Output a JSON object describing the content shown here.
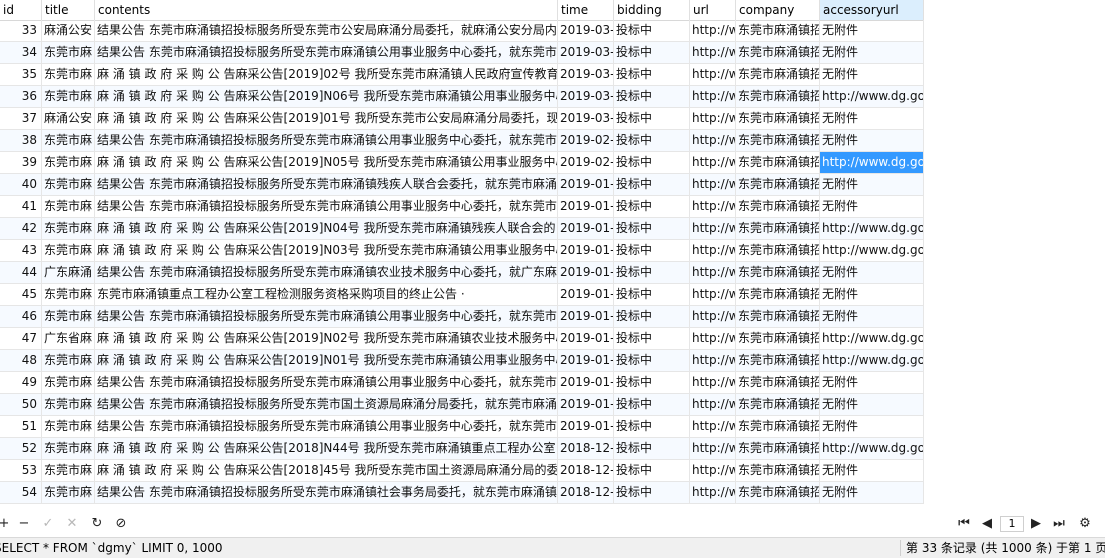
{
  "columns": [
    "id",
    "title",
    "contents",
    "time",
    "bidding",
    "url",
    "company",
    "accessoryurl"
  ],
  "rows": [
    {
      "id": "33",
      "title": "麻涌公安",
      "contents": "结果公告 东莞市麻涌镇招投标服务所受东莞市公安局麻涌分局委托，就麻涌公安分局内",
      "time": "2019-03-",
      "bidding": "投标中",
      "url": "http://w",
      "company": "东莞市麻涌镇招",
      "accessoryurl": "无附件"
    },
    {
      "id": "34",
      "title": "东莞市麻",
      "contents": "结果公告 东莞市麻涌镇招投标服务所受东莞市麻涌镇公用事业服务中心委托，就东莞市",
      "time": "2019-03-",
      "bidding": "投标中",
      "url": "http://w",
      "company": "东莞市麻涌镇招",
      "accessoryurl": "无附件"
    },
    {
      "id": "35",
      "title": "东莞市麻",
      "contents": "麻 涌 镇 政 府 采 购 公 告麻采公告[2019]02号 我所受东莞市麻涌镇人民政府宣传教育",
      "time": "2019-03-",
      "bidding": "投标中",
      "url": "http://w",
      "company": "东莞市麻涌镇招",
      "accessoryurl": "无附件"
    },
    {
      "id": "36",
      "title": "东莞市麻",
      "contents": "麻 涌 镇 政 府 采 购 公 告麻采公告[2019]N06号 我所受东莞市麻涌镇公用事业服务中心",
      "time": "2019-03-",
      "bidding": "投标中",
      "url": "http://w",
      "company": "东莞市麻涌镇招",
      "accessoryurl": "http://www.dg.go"
    },
    {
      "id": "37",
      "title": "麻涌公安",
      "contents": "麻 涌 镇 政 府 采 购 公 告麻采公告[2019]01号 我所受东莞市公安局麻涌分局委托，现",
      "time": "2019-03-",
      "bidding": "投标中",
      "url": "http://w",
      "company": "东莞市麻涌镇招",
      "accessoryurl": "无附件"
    },
    {
      "id": "38",
      "title": "东莞市麻",
      "contents": "结果公告 东莞市麻涌镇招投标服务所受东莞市麻涌镇公用事业服务中心委托，就东莞市",
      "time": "2019-02-",
      "bidding": "投标中",
      "url": "http://w",
      "company": "东莞市麻涌镇招",
      "accessoryurl": "无附件"
    },
    {
      "id": "39",
      "title": "东莞市麻",
      "contents": "麻 涌 镇 政 府 采 购 公 告麻采公告[2019]N05号 我所受东莞市麻涌镇公用事业服务中心",
      "time": "2019-02-",
      "bidding": "投标中",
      "url": "http://w",
      "company": "东莞市麻涌镇招",
      "accessoryurl": "http://www.dg.go",
      "highlight": true
    },
    {
      "id": "40",
      "title": "东莞市麻",
      "contents": "结果公告 东莞市麻涌镇招投标服务所受东莞市麻涌镇残疾人联合会委托，就东莞市麻涌",
      "time": "2019-01-",
      "bidding": "投标中",
      "url": "http://w",
      "company": "东莞市麻涌镇招",
      "accessoryurl": "无附件"
    },
    {
      "id": "41",
      "title": "东莞市麻",
      "contents": "结果公告 东莞市麻涌镇招投标服务所受东莞市麻涌镇公用事业服务中心委托，就东莞市",
      "time": "2019-01-",
      "bidding": "投标中",
      "url": "http://w",
      "company": "东莞市麻涌镇招",
      "accessoryurl": "无附件"
    },
    {
      "id": "42",
      "title": "东莞市麻",
      "contents": "麻 涌 镇 政 府 采 购 公 告麻采公告[2019]N04号 我所受东莞市麻涌镇残疾人联合会的",
      "time": "2019-01-",
      "bidding": "投标中",
      "url": "http://w",
      "company": "东莞市麻涌镇招",
      "accessoryurl": "http://www.dg.go"
    },
    {
      "id": "43",
      "title": "东莞市麻",
      "contents": "麻 涌 镇 政 府 采 购 公 告麻采公告[2019]N03号 我所受东莞市麻涌镇公用事业服务中心",
      "time": "2019-01-",
      "bidding": "投标中",
      "url": "http://w",
      "company": "东莞市麻涌镇招",
      "accessoryurl": "http://www.dg.go"
    },
    {
      "id": "44",
      "title": "广东麻涌",
      "contents": "结果公告 东莞市麻涌镇招投标服务所受东莞市麻涌镇农业技术服务中心委托，就广东麻",
      "time": "2019-01-",
      "bidding": "投标中",
      "url": "http://w",
      "company": "东莞市麻涌镇招",
      "accessoryurl": "无附件"
    },
    {
      "id": "45",
      "title": "东莞市麻",
      "contents": "东莞市麻涌镇重点工程办公室工程检测服务资格采购项目的终止公告 ·",
      "time": "2019-01-",
      "bidding": "投标中",
      "url": "http://w",
      "company": "东莞市麻涌镇招",
      "accessoryurl": "无附件"
    },
    {
      "id": "46",
      "title": "东莞市麻",
      "contents": "结果公告 东莞市麻涌镇招投标服务所受东莞市麻涌镇公用事业服务中心委托，就东莞市",
      "time": "2019-01-",
      "bidding": "投标中",
      "url": "http://w",
      "company": "东莞市麻涌镇招",
      "accessoryurl": "无附件"
    },
    {
      "id": "47",
      "title": "广东省麻",
      "contents": "麻 涌 镇 政 府 采 购 公 告麻采公告[2019]N02号 我所受东莞市麻涌镇农业技术服务中心",
      "time": "2019-01-",
      "bidding": "投标中",
      "url": "http://w",
      "company": "东莞市麻涌镇招",
      "accessoryurl": "http://www.dg.go"
    },
    {
      "id": "48",
      "title": "东莞市麻",
      "contents": "麻 涌 镇 政 府 采 购 公 告麻采公告[2019]N01号 我所受东莞市麻涌镇公用事业服务中心",
      "time": "2019-01-",
      "bidding": "投标中",
      "url": "http://w",
      "company": "东莞市麻涌镇招",
      "accessoryurl": "http://www.dg.go"
    },
    {
      "id": "49",
      "title": "东莞市麻",
      "contents": "结果公告 东莞市麻涌镇招投标服务所受东莞市麻涌镇公用事业服务中心委托，就东莞市",
      "time": "2019-01-",
      "bidding": "投标中",
      "url": "http://w",
      "company": "东莞市麻涌镇招",
      "accessoryurl": "无附件"
    },
    {
      "id": "50",
      "title": "东莞市麻",
      "contents": "结果公告 东莞市麻涌镇招投标服务所受东莞市国土资源局麻涌分局委托，就东莞市麻涌",
      "time": "2019-01-",
      "bidding": "投标中",
      "url": "http://w",
      "company": "东莞市麻涌镇招",
      "accessoryurl": "无附件"
    },
    {
      "id": "51",
      "title": "东莞市麻",
      "contents": "结果公告 东莞市麻涌镇招投标服务所受东莞市麻涌镇公用事业服务中心委托，就东莞市",
      "time": "2019-01-",
      "bidding": "投标中",
      "url": "http://w",
      "company": "东莞市麻涌镇招",
      "accessoryurl": "无附件"
    },
    {
      "id": "52",
      "title": "东莞市麻",
      "contents": "麻 涌 镇 政 府 采 购 公 告麻采公告[2018]N44号 我所受东莞市麻涌镇重点工程办公室",
      "time": "2018-12-",
      "bidding": "投标中",
      "url": "http://w",
      "company": "东莞市麻涌镇招",
      "accessoryurl": "http://www.dg.go"
    },
    {
      "id": "53",
      "title": "东莞市麻",
      "contents": "麻 涌 镇 政 府 采 购 公 告麻采公告[2018]45号 我所受东莞市国土资源局麻涌分局的委",
      "time": "2018-12-",
      "bidding": "投标中",
      "url": "http://w",
      "company": "东莞市麻涌镇招",
      "accessoryurl": "无附件"
    },
    {
      "id": "54",
      "title": "东莞市麻",
      "contents": "结果公告 东莞市麻涌镇招投标服务所受东莞市麻涌镇社会事务局委托，就东莞市麻涌镇",
      "time": "2018-12-",
      "bidding": "投标中",
      "url": "http://w",
      "company": "东莞市麻涌镇招",
      "accessoryurl": "无附件"
    }
  ],
  "toolbar": {
    "add_icon": "plus-icon",
    "delete_icon": "minus-icon",
    "apply_icon": "check-icon",
    "discard_icon": "x-icon",
    "refresh_icon": "refresh-icon",
    "stop_icon": "stop-icon",
    "page_value": "1"
  },
  "status": {
    "sql": "SELECT * FROM `dgmy` LIMIT 0, 1000",
    "record_info": "第 33 条记录 (共 1000 条) 于第 1 页"
  },
  "colors": {
    "selection": "#3399ff",
    "header_selected": "#dbeefd",
    "alt_row": "#f6faff"
  }
}
